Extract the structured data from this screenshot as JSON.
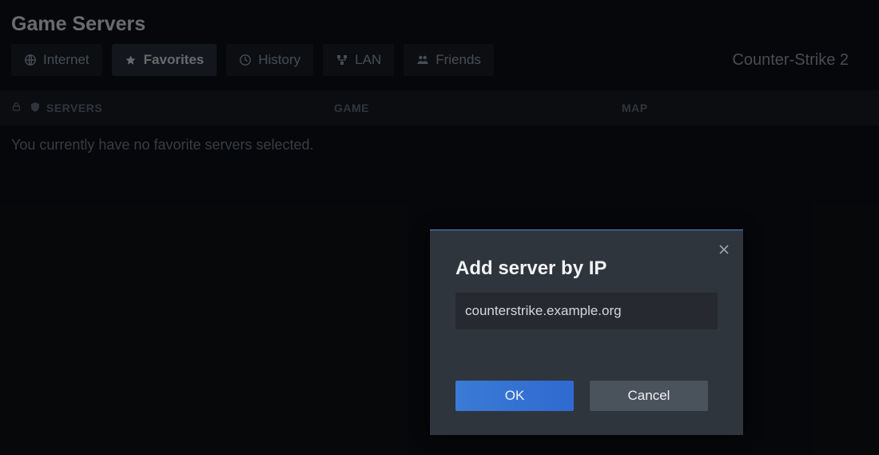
{
  "header": {
    "title": "Game Servers"
  },
  "tabs": [
    {
      "label": "Internet",
      "icon": "globe-icon",
      "active": false
    },
    {
      "label": "Favorites",
      "icon": "star-icon",
      "active": true
    },
    {
      "label": "History",
      "icon": "clock-icon",
      "active": false
    },
    {
      "label": "LAN",
      "icon": "lan-icon",
      "active": false
    },
    {
      "label": "Friends",
      "icon": "friends-icon",
      "active": false
    }
  ],
  "current_game": "Counter-Strike 2",
  "table": {
    "columns": {
      "servers": "SERVERS",
      "game": "GAME",
      "map": "MAP"
    },
    "empty_message": "You currently have no favorite servers selected."
  },
  "dialog": {
    "title": "Add server by IP",
    "input_value": "counterstrike.example.org",
    "ok_label": "OK",
    "cancel_label": "Cancel"
  }
}
